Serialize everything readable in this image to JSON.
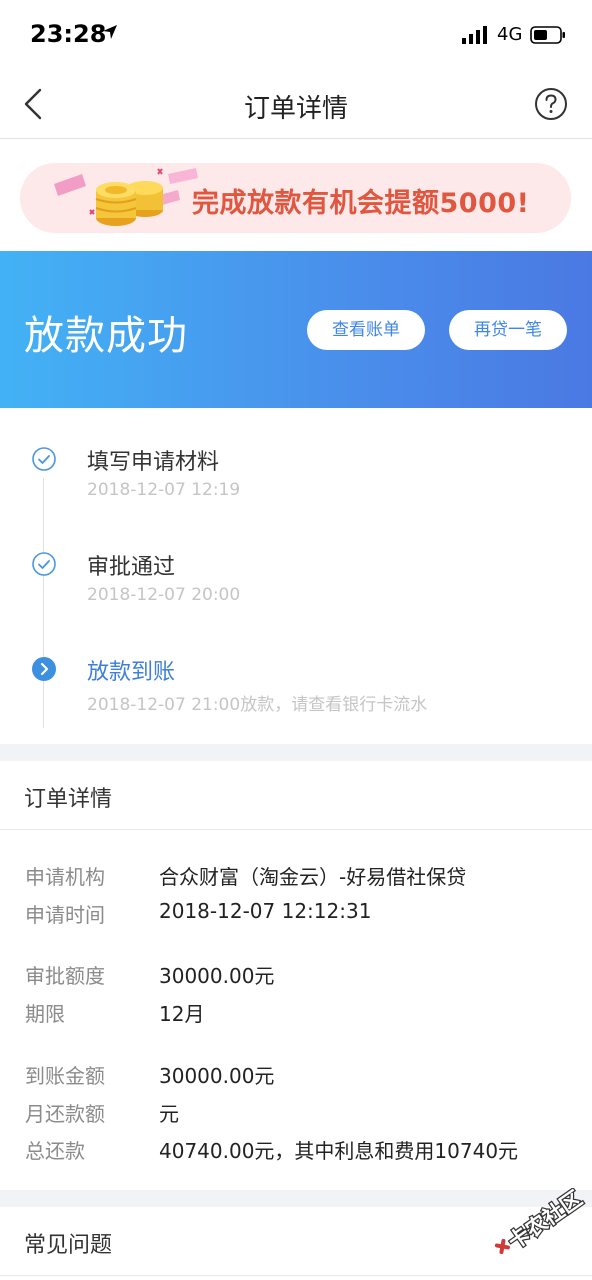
{
  "status_bar": {
    "time": "23:28",
    "network": "4G"
  },
  "nav": {
    "title": "订单详情"
  },
  "promo": {
    "text": "完成放款有机会提额5000!"
  },
  "banner": {
    "title": "放款成功",
    "btn_bill": "查看账单",
    "btn_loan": "再贷一笔"
  },
  "steps": [
    {
      "title": "填写申请材料",
      "time": "2018-12-07 12:19"
    },
    {
      "title": "审批通过",
      "time": "2018-12-07 20:00"
    },
    {
      "title": "放款到账",
      "time": "2018-12-07 21:00放款，请查看银行卡流水"
    }
  ],
  "order": {
    "header": "订单详情",
    "rows": [
      {
        "label": "申请机构",
        "value": "合众财富（淘金云）-好易借社保贷"
      },
      {
        "label": "申请时间",
        "value": "2018-12-07 12:12:31"
      },
      {
        "label": "审批额度",
        "value": "30000.00元"
      },
      {
        "label": "期限",
        "value": "12月"
      },
      {
        "label": "到账金额",
        "value": "30000.00元"
      },
      {
        "label": "月还款额",
        "value": "元"
      },
      {
        "label": "总还款",
        "value": "40740.00元，其中利息和费用10740元"
      }
    ]
  },
  "faq": {
    "header": "常见问题"
  },
  "watermark": {
    "text": "卡农社区"
  },
  "colors": {
    "accent": "#3d7fd9",
    "banner_start": "#43b2f5",
    "banner_end": "#4a79e3",
    "promo_text": "#e0563f"
  }
}
